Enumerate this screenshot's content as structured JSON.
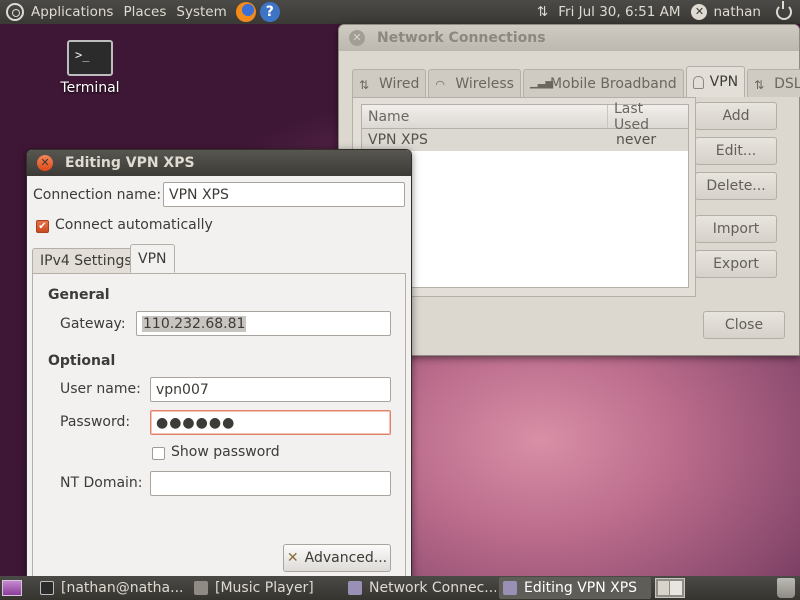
{
  "top_panel": {
    "menus": [
      "Applications",
      "Places",
      "System"
    ],
    "datetime": "Fri Jul 30,  6:51 AM",
    "user": "nathan",
    "icons": [
      "ubuntu-logo-icon",
      "firefox-icon",
      "help-icon",
      "network-arrows-icon",
      "user-status-icon",
      "power-icon"
    ]
  },
  "desktop": {
    "terminal_label": "Terminal",
    "terminal_prompt": ">_"
  },
  "network_connections": {
    "title": "Network Connections",
    "tabs": [
      "Wired",
      "Wireless",
      "Mobile Broadband",
      "VPN",
      "DSL"
    ],
    "selected_tab": "VPN",
    "columns": [
      "Name",
      "Last Used"
    ],
    "rows": [
      {
        "name": "VPN XPS",
        "last_used": "never"
      }
    ],
    "buttons": {
      "add": "Add",
      "edit": "Edit...",
      "delete": "Delete...",
      "import": "Import",
      "export": "Export",
      "close": "Close"
    }
  },
  "editing_vpn": {
    "title": "Editing VPN XPS",
    "connection_name_label": "Connection name:",
    "connection_name_value": "VPN XPS",
    "connect_automatically_label": "Connect automatically",
    "connect_automatically": true,
    "tabs": [
      "IPv4 Settings",
      "VPN"
    ],
    "selected_tab": "VPN",
    "general_label": "General",
    "gateway_label": "Gateway:",
    "gateway_value": "110.232.68.81",
    "optional_label": "Optional",
    "username_label": "User name:",
    "username_value": "vpn007",
    "password_label": "Password:",
    "password_value": "●●●●●●",
    "show_password_label": "Show password",
    "show_password": false,
    "nt_domain_label": "NT Domain:",
    "nt_domain_value": "",
    "advanced_button": "Advanced..."
  },
  "bottom_panel": {
    "tasks": [
      {
        "label": "[nathan@natha..."
      },
      {
        "label": "[Music Player]"
      },
      {
        "label": "Network Connec..."
      },
      {
        "label": "Editing VPN XPS"
      }
    ]
  },
  "colors": {
    "accent": "#df4a17",
    "panel": "#3c3b37",
    "window_bg": "#f2f1f0"
  }
}
